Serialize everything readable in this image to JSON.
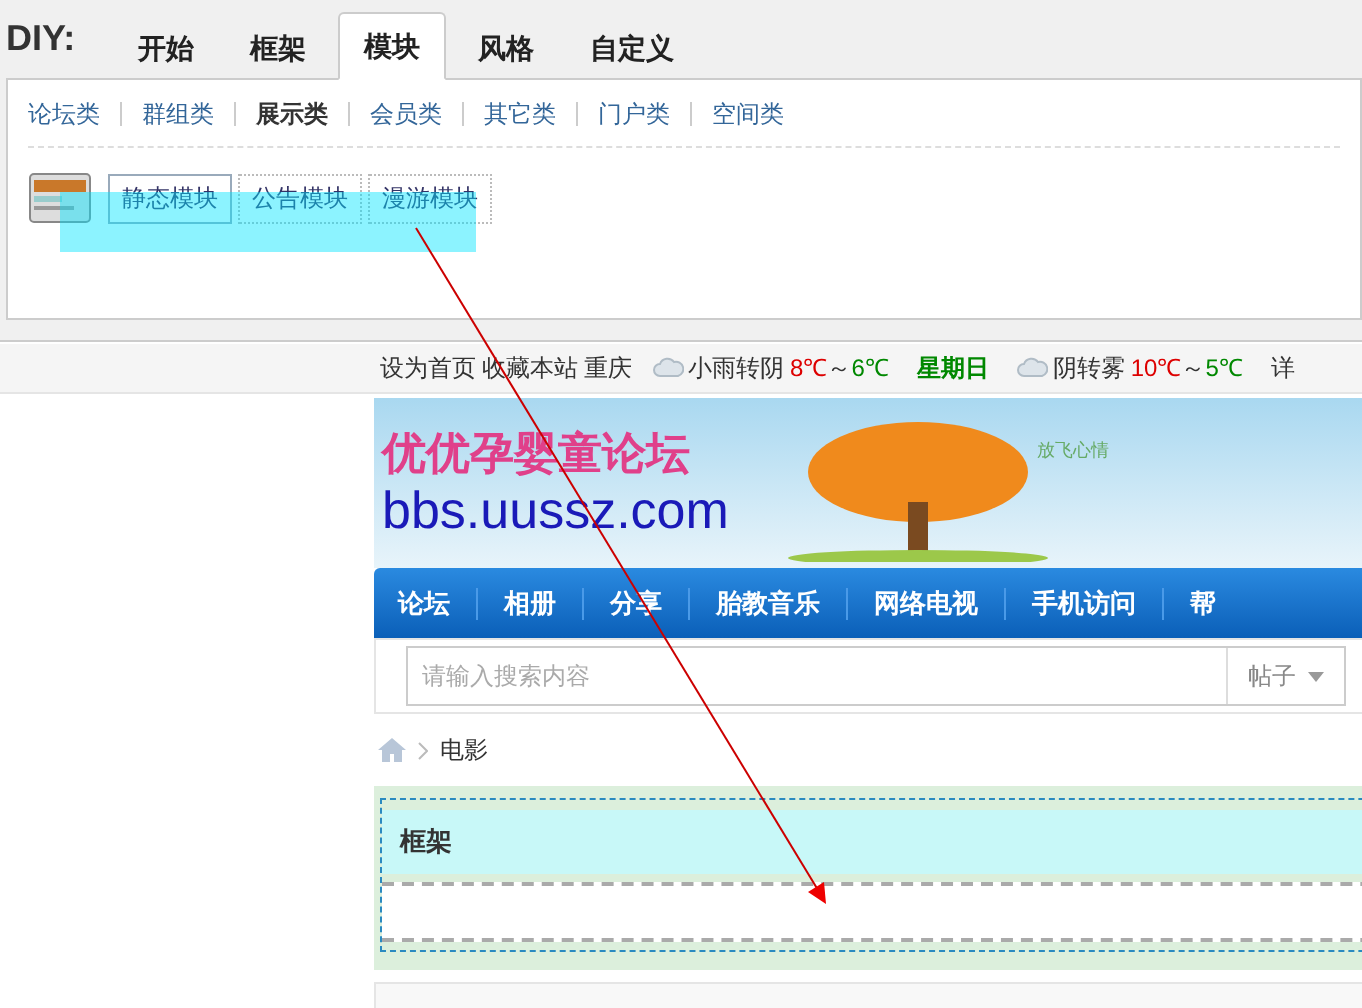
{
  "diy": {
    "label": "DIY:",
    "tabs": [
      {
        "label": "开始",
        "selected": false
      },
      {
        "label": "框架",
        "selected": false
      },
      {
        "label": "模块",
        "selected": true
      },
      {
        "label": "风格",
        "selected": false
      },
      {
        "label": "自定义",
        "selected": false
      }
    ],
    "categories": [
      {
        "label": "论坛类",
        "selected": false
      },
      {
        "label": "群组类",
        "selected": false
      },
      {
        "label": "展示类",
        "selected": true
      },
      {
        "label": "会员类",
        "selected": false
      },
      {
        "label": "其它类",
        "selected": false
      },
      {
        "label": "门户类",
        "selected": false
      },
      {
        "label": "空间类",
        "selected": false
      }
    ],
    "modules": [
      {
        "label": "静态模块",
        "selected": true
      },
      {
        "label": "公告模块",
        "selected": false
      },
      {
        "label": "漫游模块",
        "selected": false
      }
    ]
  },
  "topbar": {
    "links": [
      "设为首页",
      "收藏本站"
    ],
    "city": "重庆",
    "weather": [
      {
        "kind": "rain",
        "text": "小雨转阴",
        "high": "8℃",
        "sep": "～",
        "low": "6℃"
      },
      {
        "kind": "day",
        "text": "星期日"
      },
      {
        "kind": "fog",
        "text": "阴转雾",
        "high": "10℃",
        "sep": "～",
        "low": "5℃"
      },
      {
        "kind": "link",
        "text": "详"
      }
    ]
  },
  "banner": {
    "title": "优优孕婴童论坛",
    "url": "bbs.uussz.com",
    "slogan": "放飞心情"
  },
  "nav": [
    "论坛",
    "相册",
    "分享",
    "胎教音乐",
    "网络电视",
    "手机访问",
    "帮"
  ],
  "search": {
    "placeholder": "请输入搜索内容",
    "scope": "帖子"
  },
  "breadcrumb": [
    "电影"
  ],
  "frame": {
    "title": "框架"
  }
}
